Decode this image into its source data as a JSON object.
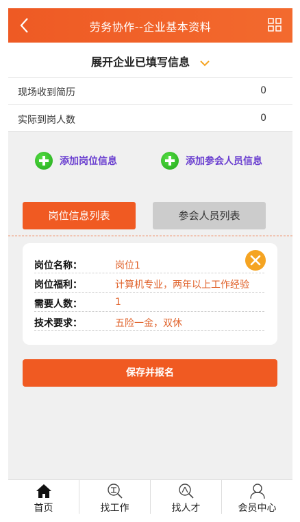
{
  "header": {
    "title": "劳务协作--企业基本资料",
    "back_icon": "chevron-left-icon",
    "menu_icon": "grid-icon"
  },
  "expand": {
    "label": "展开企业已填写信息",
    "icon": "chevron-down-icon",
    "icon_color": "#f5a422"
  },
  "stats": [
    {
      "label": "现场收到简历",
      "value": "0"
    },
    {
      "label": "实际到岗人数",
      "value": "0"
    }
  ],
  "actions": {
    "add_position": "添加岗位信息",
    "add_attendee": "添加参会人员信息",
    "icon": "plus-circle-icon"
  },
  "tabs": {
    "position_list": "岗位信息列表",
    "attendee_list": "参会人员列表",
    "active": "position_list"
  },
  "card": {
    "fields": [
      {
        "label": "岗位名称：",
        "value": "岗位1"
      },
      {
        "label": "岗位福利：",
        "value": "计算机专业，两年以上工作经验"
      },
      {
        "label": "需要人数：",
        "value": "1"
      },
      {
        "label": "技术要求：",
        "value": "五险一金，双休"
      }
    ],
    "close_icon": "close-icon"
  },
  "save_button": "保存并报名",
  "tabbar": [
    {
      "label": "首页",
      "icon": "home-icon"
    },
    {
      "label": "找工作",
      "icon": "search-job-icon"
    },
    {
      "label": "找人才",
      "icon": "search-talent-icon"
    },
    {
      "label": "会员中心",
      "icon": "user-icon"
    }
  ],
  "colors": {
    "primary": "#f05a22",
    "accent": "#f5a422",
    "link_purple": "#6a3fd0",
    "value_orange": "#e0622a"
  }
}
